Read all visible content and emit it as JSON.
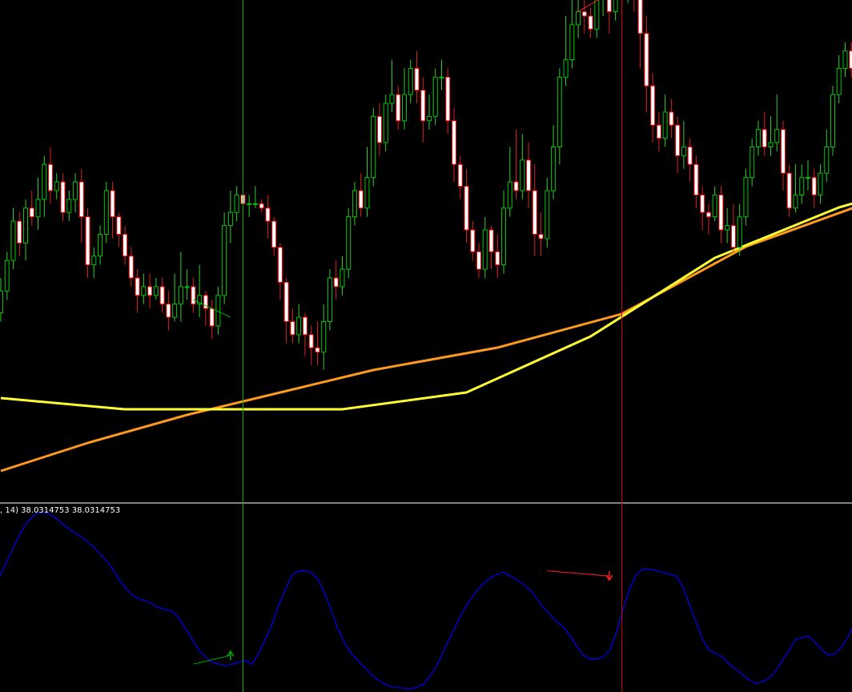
{
  "chart_data": [
    {
      "type": "candlestick",
      "panel": "price",
      "colors": {
        "bull": "#00c800",
        "bear": "#ff0000",
        "body_bull": "#000000",
        "body_bear": "#ffffff",
        "wick_bull": "#2fd02f",
        "wick_bear": "#e02020"
      },
      "y_range": [
        0,
        100
      ],
      "candles": [
        [
          32,
          37,
          30,
          40
        ],
        [
          37,
          44,
          35,
          46
        ],
        [
          44,
          53,
          42,
          56
        ],
        [
          53,
          48,
          45,
          55
        ],
        [
          48,
          56,
          44,
          58
        ],
        [
          56,
          54,
          52,
          60
        ],
        [
          54,
          58,
          51,
          63
        ],
        [
          58,
          66,
          54,
          68
        ],
        [
          66,
          60,
          57,
          70
        ],
        [
          60,
          62,
          58,
          64
        ],
        [
          62,
          55,
          53,
          64
        ],
        [
          55,
          58,
          53,
          60
        ],
        [
          58,
          62,
          55,
          64
        ],
        [
          62,
          54,
          48,
          65
        ],
        [
          54,
          43,
          40,
          56
        ],
        [
          43,
          45,
          40,
          47
        ],
        [
          45,
          50,
          43,
          52
        ],
        [
          50,
          60,
          48,
          62
        ],
        [
          60,
          54,
          49,
          62
        ],
        [
          54,
          50,
          47,
          55
        ],
        [
          50,
          45,
          43,
          52
        ],
        [
          45,
          40,
          38,
          47
        ],
        [
          40,
          36,
          32,
          42
        ],
        [
          36,
          38,
          34,
          41
        ],
        [
          38,
          36,
          33,
          41
        ],
        [
          36,
          38,
          35,
          40
        ],
        [
          38,
          34,
          32,
          40
        ],
        [
          34,
          31,
          28,
          37
        ],
        [
          31,
          34,
          30,
          41
        ],
        [
          34,
          38,
          30,
          46
        ],
        [
          38,
          38,
          35,
          42
        ],
        [
          38,
          34,
          32,
          40
        ],
        [
          34,
          36,
          31,
          43
        ],
        [
          36,
          33,
          29,
          37
        ],
        [
          33,
          29,
          26,
          35
        ],
        [
          29,
          36,
          27,
          38
        ],
        [
          36,
          52,
          34,
          55
        ],
        [
          52,
          55,
          48,
          60
        ],
        [
          55,
          59,
          53,
          61
        ],
        [
          59,
          57,
          55,
          62
        ],
        [
          57,
          57,
          54,
          59
        ],
        [
          57,
          57,
          56,
          61
        ],
        [
          57,
          56,
          55,
          58
        ],
        [
          56,
          53,
          49,
          59
        ],
        [
          53,
          47,
          45,
          54
        ],
        [
          47,
          39,
          35,
          48
        ],
        [
          39,
          30,
          25,
          40
        ],
        [
          30,
          27,
          25,
          33
        ],
        [
          27,
          31,
          25,
          34
        ],
        [
          31,
          27,
          22,
          32
        ],
        [
          27,
          24,
          20,
          29
        ],
        [
          24,
          23,
          20,
          30
        ],
        [
          23,
          30,
          19,
          34
        ],
        [
          30,
          40,
          28,
          42
        ],
        [
          40,
          38,
          35,
          44
        ],
        [
          38,
          42,
          36,
          45
        ],
        [
          42,
          54,
          40,
          56
        ],
        [
          54,
          60,
          52,
          62
        ],
        [
          60,
          56,
          54,
          64
        ],
        [
          56,
          63,
          54,
          70
        ],
        [
          63,
          77,
          61,
          79
        ],
        [
          77,
          71,
          68,
          80
        ],
        [
          71,
          80,
          69,
          82
        ],
        [
          80,
          82,
          78,
          90
        ],
        [
          82,
          76,
          74,
          84
        ],
        [
          76,
          82,
          74,
          88
        ],
        [
          82,
          88,
          80,
          90
        ],
        [
          88,
          83,
          80,
          92
        ],
        [
          83,
          76,
          71,
          86
        ],
        [
          76,
          77,
          74,
          82
        ],
        [
          77,
          86,
          75,
          88
        ],
        [
          86,
          86,
          83,
          90
        ],
        [
          86,
          76,
          73,
          88
        ],
        [
          76,
          66,
          62,
          79
        ],
        [
          66,
          61,
          58,
          68
        ],
        [
          61,
          51,
          48,
          65
        ],
        [
          51,
          46,
          44,
          53
        ],
        [
          46,
          42,
          40,
          48
        ],
        [
          42,
          51,
          40,
          54
        ],
        [
          51,
          46,
          42,
          52
        ],
        [
          46,
          43,
          40,
          50
        ],
        [
          43,
          56,
          41,
          60
        ],
        [
          56,
          62,
          54,
          70
        ],
        [
          62,
          60,
          58,
          74
        ],
        [
          60,
          67,
          58,
          73
        ],
        [
          67,
          60,
          56,
          71
        ],
        [
          60,
          50,
          45,
          66
        ],
        [
          50,
          49,
          45,
          55
        ],
        [
          49,
          60,
          47,
          63
        ],
        [
          60,
          70,
          58,
          75
        ],
        [
          70,
          86,
          66,
          88
        ],
        [
          86,
          90,
          84,
          100
        ],
        [
          90,
          98,
          88,
          106
        ],
        [
          98,
          101,
          95,
          104
        ],
        [
          101,
          100,
          96,
          105
        ],
        [
          100,
          97,
          95,
          102
        ],
        [
          97,
          104,
          95,
          107
        ],
        [
          104,
          109,
          100,
          111
        ],
        [
          109,
          101,
          96,
          112
        ],
        [
          101,
          111,
          99,
          112
        ],
        [
          111,
          106,
          100,
          114
        ],
        [
          106,
          112,
          103,
          118
        ],
        [
          112,
          106,
          101,
          115
        ],
        [
          106,
          96,
          88,
          112
        ],
        [
          96,
          84,
          78,
          100
        ],
        [
          84,
          75,
          71,
          87
        ],
        [
          75,
          72,
          69,
          78
        ],
        [
          72,
          78,
          70,
          82
        ],
        [
          78,
          75,
          72,
          81
        ],
        [
          75,
          68,
          64,
          77
        ],
        [
          68,
          70,
          65,
          76
        ],
        [
          70,
          66,
          62,
          72
        ],
        [
          66,
          59,
          56,
          68
        ],
        [
          59,
          55,
          51,
          61
        ],
        [
          55,
          54,
          50,
          57
        ],
        [
          54,
          59,
          53,
          61
        ],
        [
          59,
          51,
          48,
          61
        ],
        [
          51,
          52,
          48,
          56
        ],
        [
          52,
          47,
          46,
          57
        ],
        [
          47,
          54,
          45,
          57
        ],
        [
          54,
          63,
          52,
          65
        ],
        [
          63,
          70,
          61,
          72
        ],
        [
          70,
          74,
          68,
          76
        ],
        [
          74,
          70,
          68,
          78
        ],
        [
          70,
          71,
          68,
          77
        ],
        [
          71,
          74,
          69,
          82
        ],
        [
          74,
          64,
          60,
          76
        ],
        [
          64,
          56,
          54,
          66
        ],
        [
          56,
          59,
          55,
          66
        ],
        [
          59,
          63,
          57,
          66
        ],
        [
          63,
          63,
          60,
          67
        ],
        [
          63,
          59,
          56,
          65
        ],
        [
          59,
          64,
          57,
          66
        ],
        [
          64,
          70,
          62,
          74
        ],
        [
          70,
          82,
          68,
          84
        ],
        [
          82,
          88,
          80,
          91
        ],
        [
          88,
          92,
          86,
          94
        ],
        [
          92,
          88,
          86,
          94
        ]
      ],
      "moving_averages": [
        {
          "color": "#ff9a1f",
          "points": [
            [
              0,
              0
            ],
            [
              14,
              5
            ],
            [
              30,
              10
            ],
            [
              45,
              14
            ],
            [
              60,
              18
            ],
            [
              80,
              22
            ],
            [
              100,
              28
            ],
            [
              120,
              40
            ],
            [
              140,
              48
            ],
            [
              160,
              54
            ],
            [
              180,
              60
            ]
          ]
        },
        {
          "color": "#ffff33",
          "points": [
            [
              0,
              13
            ],
            [
              20,
              11
            ],
            [
              35,
              11
            ],
            [
              55,
              11
            ],
            [
              75,
              14
            ],
            [
              95,
              24
            ],
            [
              115,
              38
            ],
            [
              135,
              47
            ],
            [
              160,
              55
            ],
            [
              180,
              59
            ]
          ]
        }
      ],
      "divergence_lines": [
        {
          "color": "#00b000",
          "from": [
            31,
            35
          ],
          "to": [
            37,
            31
          ]
        },
        {
          "color": "#ff2020",
          "from": [
            93,
            101
          ],
          "to": [
            99,
            106
          ]
        }
      ],
      "vertical_markers": [
        {
          "color": "#00b400",
          "at": 39
        },
        {
          "color": "#c80000",
          "at": 100
        }
      ]
    },
    {
      "type": "line",
      "panel": "indicator",
      "label": ", 14) 38.0314753 38.0314753",
      "y_range": [
        0,
        100
      ],
      "color": "#0000ff",
      "values": [
        64,
        72,
        80,
        88,
        94,
        98,
        100,
        100,
        98,
        95,
        92,
        89,
        87,
        84,
        81,
        77,
        73,
        68,
        62,
        57,
        53,
        51,
        50,
        48,
        46,
        45,
        44,
        40,
        34,
        28,
        22,
        18,
        15,
        14,
        13,
        14,
        15,
        16,
        14,
        20,
        28,
        36,
        47,
        56,
        64,
        67,
        67,
        66,
        62,
        54,
        44,
        34,
        26,
        20,
        16,
        12,
        8,
        5,
        3,
        1,
        1,
        0,
        0,
        1,
        3,
        8,
        14,
        22,
        30,
        38,
        45,
        51,
        56,
        60,
        63,
        65,
        66,
        64,
        62,
        59,
        56,
        51,
        46,
        42,
        38,
        35,
        30,
        24,
        19,
        17,
        17,
        18,
        22,
        32,
        45,
        57,
        65,
        68,
        68,
        67,
        66,
        65,
        64,
        58,
        48,
        38,
        28,
        22,
        20,
        18,
        14,
        11,
        8,
        5,
        3,
        4,
        6,
        10,
        16,
        22,
        28,
        29,
        30,
        26,
        22,
        19,
        20,
        24,
        30,
        38
      ],
      "divergence_lines": [
        {
          "color": "#00b000",
          "from": [
            31,
            14
          ],
          "to": [
            37,
            19
          ],
          "arrow": "up"
        },
        {
          "color": "#ff2020",
          "from": [
            88,
            67
          ],
          "to": [
            98,
            64
          ],
          "arrow": "down"
        }
      ]
    }
  ]
}
